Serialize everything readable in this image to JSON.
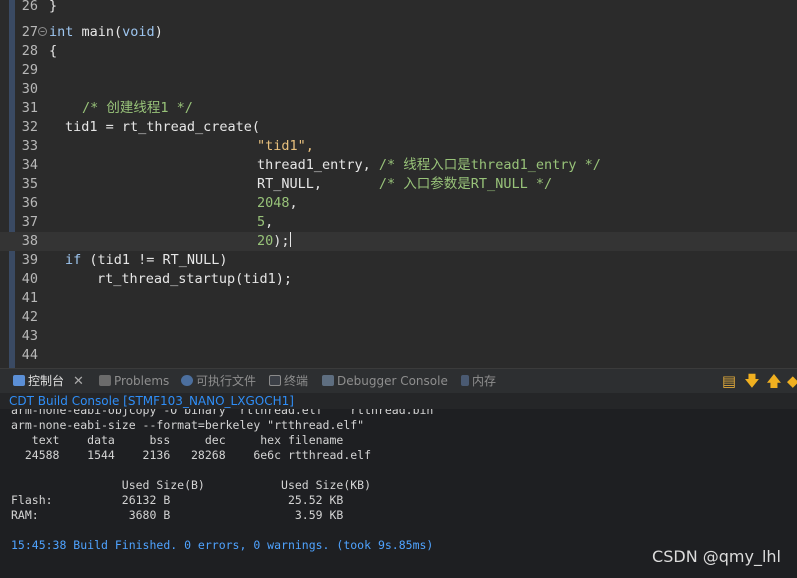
{
  "editor": {
    "lines": [
      {
        "n": "26",
        "text": "}"
      },
      {
        "n": "27",
        "text": "int main(void)"
      },
      {
        "n": "28",
        "text": "{"
      },
      {
        "n": "29",
        "text": ""
      },
      {
        "n": "30",
        "text": ""
      },
      {
        "n": "31",
        "text": "   /* 创建线程1 */"
      },
      {
        "n": "32",
        "text": "tid1 = rt_thread_create("
      },
      {
        "n": "33",
        "text": "\"tid1\","
      },
      {
        "n": "34",
        "text": "thread1_entry, /* 线程入口是thread1_entry */"
      },
      {
        "n": "35",
        "text": "RT_NULL,       /* 入口参数是RT_NULL */"
      },
      {
        "n": "36",
        "text": "2048,"
      },
      {
        "n": "37",
        "text": "5,"
      },
      {
        "n": "38",
        "text": "20);"
      },
      {
        "n": "39",
        "text": "if (tid1 != RT_NULL)"
      },
      {
        "n": "40",
        "text": "rt_thread_startup(tid1);"
      },
      {
        "n": "41",
        "text": ""
      },
      {
        "n": "42",
        "text": ""
      },
      {
        "n": "43",
        "text": ""
      },
      {
        "n": "44",
        "text": ""
      }
    ],
    "code": {
      "l26": "}",
      "l27_kw": "int",
      "l27_rest": " main(",
      "l27_kw2": "void",
      "l27_close": ")",
      "l28": "{",
      "l31": "/* 创建线程1 */",
      "l32": "tid1 = rt_thread_create(",
      "l33": "\"tid1\",",
      "l34_code": "thread1_entry, ",
      "l34_cm": "/* 线程入口是thread1_entry */",
      "l35_code": "RT_NULL,       ",
      "l35_cm": "/* 入口参数是RT_NULL */",
      "l36": "2048",
      "l36_p": ",",
      "l37": "5",
      "l37_p": ",",
      "l38": "20",
      "l38_p": ");",
      "l39_kw": "if",
      "l39_rest": " (tid1 != RT_NULL)",
      "l40": "rt_thread_startup(tid1);"
    }
  },
  "tabs": [
    {
      "label": "控制台",
      "active": true
    },
    {
      "label": "Problems"
    },
    {
      "label": "可执行文件"
    },
    {
      "label": "终端"
    },
    {
      "label": "Debugger Console"
    },
    {
      "label": "内存"
    }
  ],
  "console": {
    "title": "CDT Build Console [STMF103_NANO_LXGOCH1]",
    "lines": [
      "arm-none-eabi-objcopy -O binary \"rtthread.elf\"  \"rtthread.bin\"",
      "arm-none-eabi-size --format=berkeley \"rtthread.elf\"",
      "   text    data     bss     dec     hex filename",
      "  24588    1544    2136   28268    6e6c rtthread.elf",
      "",
      "                Used Size(B)           Used Size(KB)",
      "Flash:          26132 B                 25.52 KB",
      "RAM:             3680 B                  3.59 KB",
      ""
    ],
    "finish": "15:45:38 Build Finished. 0 errors, 0 warnings. (took 9s.85ms)"
  },
  "watermark": "CSDN @qmy_lhl",
  "colors": {
    "editor_bg": "#2b2b2b",
    "keyword": "#9ec6f0",
    "comment": "#98c379",
    "string": "#e8c07d",
    "console_link": "#2f8ef7"
  }
}
